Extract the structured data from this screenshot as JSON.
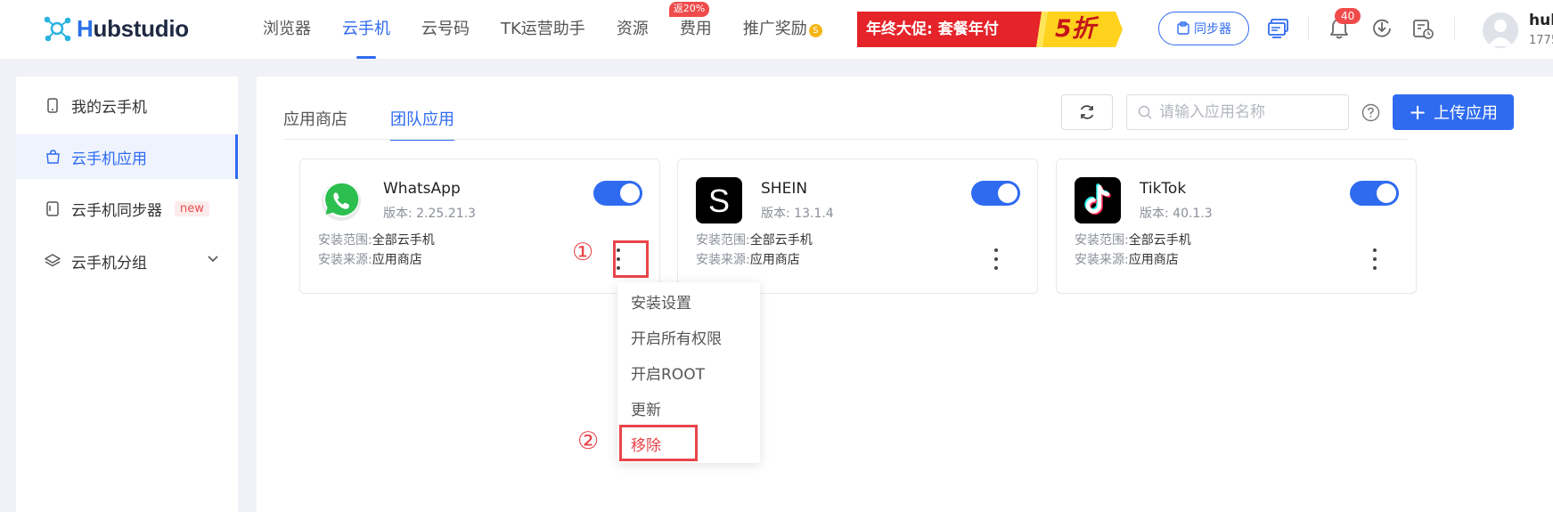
{
  "brand": {
    "logo_text": "Hubstudio",
    "logo_text_h": "H",
    "logo_text_rest": "ubstudio"
  },
  "nav": [
    {
      "label": "浏览器",
      "active": false
    },
    {
      "label": "云手机",
      "active": true
    },
    {
      "label": "云号码",
      "active": false
    },
    {
      "label": "TK运营助手",
      "active": false
    },
    {
      "label": "资源",
      "active": false
    },
    {
      "label": "费用",
      "active": false,
      "badge": "返20%"
    },
    {
      "label": "推广奖励",
      "active": false,
      "coin": "S"
    }
  ],
  "promo": {
    "text": "年终大促:  套餐年付",
    "discount": "5折"
  },
  "header": {
    "sync_label": "同步器",
    "notification_count": "40",
    "user_name": "hub",
    "user_phone": "1775"
  },
  "sidebar": {
    "items": [
      {
        "label": "我的云手机",
        "active": false,
        "icon": "phone-icon"
      },
      {
        "label": "云手机应用",
        "active": true,
        "icon": "app-bag-icon"
      },
      {
        "label": "云手机同步器",
        "active": false,
        "icon": "sync-phone-icon",
        "tag": "new"
      },
      {
        "label": "云手机分组",
        "active": false,
        "icon": "layers-icon"
      }
    ]
  },
  "main": {
    "tabs": [
      {
        "label": "应用商店",
        "active": false
      },
      {
        "label": "团队应用",
        "active": true
      }
    ],
    "search_placeholder": "请输入应用名称",
    "upload_label": "上传应用",
    "meta_labels": {
      "scope": "安装范围:",
      "source": "安装来源:"
    },
    "apps": [
      {
        "name": "WhatsApp",
        "version": "版本: 2.25.21.3",
        "scope": "全部云手机",
        "source": "应用商店",
        "enabled": true,
        "icon": "whatsapp-icon"
      },
      {
        "name": "SHEIN",
        "version": "版本: 13.1.4",
        "scope": "全部云手机",
        "source": "应用商店",
        "enabled": true,
        "icon": "shein-icon"
      },
      {
        "name": "TikTok",
        "version": "版本: 40.1.3",
        "scope": "全部云手机",
        "source": "应用商店",
        "enabled": true,
        "icon": "tiktok-icon"
      }
    ],
    "context_menu": [
      {
        "label": "安装设置",
        "danger": false
      },
      {
        "label": "开启所有权限",
        "danger": false
      },
      {
        "label": "开启ROOT",
        "danger": false
      },
      {
        "label": "更新",
        "danger": false
      },
      {
        "label": "移除",
        "danger": true
      }
    ],
    "annotations": {
      "step1": "①",
      "step2": "②"
    }
  },
  "colors": {
    "accent": "#2f6bf0",
    "danger": "#e8454a",
    "badge": "#f04b4b"
  }
}
